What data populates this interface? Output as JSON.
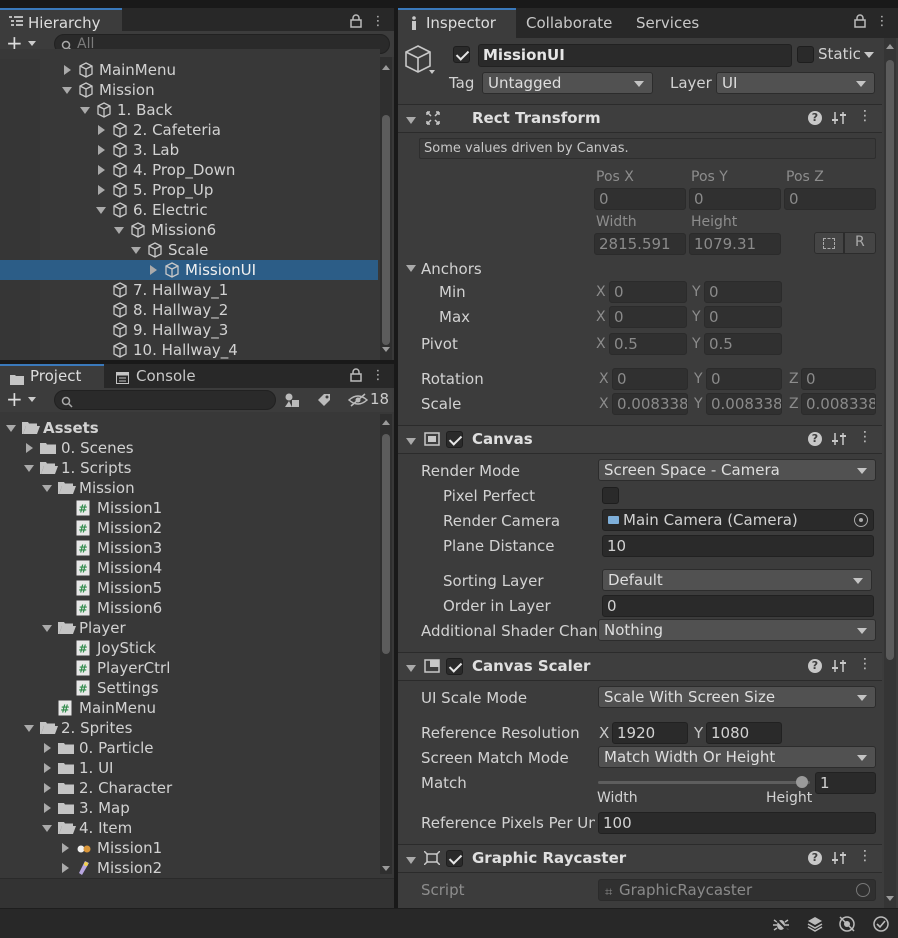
{
  "hierarchy": {
    "tab": "Hierarchy",
    "search_placeholder": "All",
    "rows": [
      {
        "label": "MainMenu"
      },
      {
        "label": "Mission"
      },
      {
        "label": "1. Back"
      },
      {
        "label": "2. Cafeteria"
      },
      {
        "label": "3. Lab"
      },
      {
        "label": "4. Prop_Down"
      },
      {
        "label": "5. Prop_Up"
      },
      {
        "label": "6. Electric"
      },
      {
        "label": "Mission6"
      },
      {
        "label": "Scale"
      },
      {
        "label": "MissionUI"
      },
      {
        "label": "7. Hallway_1"
      },
      {
        "label": "8. Hallway_2"
      },
      {
        "label": "9. Hallway_3"
      },
      {
        "label": "10. Hallway_4"
      }
    ]
  },
  "project": {
    "tabs": [
      "Project",
      "Console"
    ],
    "hidden_count": "18",
    "rows": [
      {
        "label": "Assets"
      },
      {
        "label": "0. Scenes"
      },
      {
        "label": "1. Scripts"
      },
      {
        "label": "Mission"
      },
      {
        "label": "Mission1"
      },
      {
        "label": "Mission2"
      },
      {
        "label": "Mission3"
      },
      {
        "label": "Mission4"
      },
      {
        "label": "Mission5"
      },
      {
        "label": "Mission6"
      },
      {
        "label": "Player"
      },
      {
        "label": "JoyStick"
      },
      {
        "label": "PlayerCtrl"
      },
      {
        "label": "Settings"
      },
      {
        "label": "MainMenu"
      },
      {
        "label": "2. Sprites"
      },
      {
        "label": "0. Particle"
      },
      {
        "label": "1. UI"
      },
      {
        "label": "2. Character"
      },
      {
        "label": "3. Map"
      },
      {
        "label": "4. Item"
      },
      {
        "label": "Mission1"
      },
      {
        "label": "Mission2"
      }
    ]
  },
  "inspector": {
    "tabs": [
      "Inspector",
      "Collaborate",
      "Services"
    ],
    "object_name": "MissionUI",
    "static_label": "Static",
    "tag_label": "Tag",
    "tag_value": "Untagged",
    "layer_label": "Layer",
    "layer_value": "UI",
    "rect_transform": {
      "title": "Rect Transform",
      "notice": "Some values driven by Canvas.",
      "pos_x_label": "Pos X",
      "pos_y_label": "Pos Y",
      "pos_z_label": "Pos Z",
      "pos_x": "0",
      "pos_y": "0",
      "pos_z": "0",
      "width_label": "Width",
      "height_label": "Height",
      "width": "2815.591",
      "height": "1079.31",
      "anchors_label": "Anchors",
      "min_label": "Min",
      "min_x": "0",
      "min_y": "0",
      "max_label": "Max",
      "max_x": "0",
      "max_y": "0",
      "pivot_label": "Pivot",
      "pivot_x": "0.5",
      "pivot_y": "0.5",
      "rotation_label": "Rotation",
      "rot_x": "0",
      "rot_y": "0",
      "rot_z": "0",
      "scale_label": "Scale",
      "scale_x": "0.008338",
      "scale_y": "0.008338",
      "scale_z": "0.008338",
      "r_button": "R"
    },
    "canvas": {
      "title": "Canvas",
      "render_mode_label": "Render Mode",
      "render_mode": "Screen Space - Camera",
      "pixel_perfect_label": "Pixel Perfect",
      "render_camera_label": "Render Camera",
      "render_camera": "Main Camera (Camera)",
      "plane_distance_label": "Plane Distance",
      "plane_distance": "10",
      "sorting_layer_label": "Sorting Layer",
      "sorting_layer": "Default",
      "order_label": "Order in Layer",
      "order": "0",
      "shader_label": "Additional Shader Chann",
      "shader": "Nothing"
    },
    "canvas_scaler": {
      "title": "Canvas Scaler",
      "scale_mode_label": "UI Scale Mode",
      "scale_mode": "Scale With Screen Size",
      "ref_res_label": "Reference Resolution",
      "ref_x": "1920",
      "ref_y": "1080",
      "match_mode_label": "Screen Match Mode",
      "match_mode": "Match Width Or Height",
      "match_label": "Match",
      "match_value": "1",
      "match_fraction": 1,
      "width_label": "Width",
      "height_label": "Height",
      "ref_ppu_label": "Reference Pixels Per Un",
      "ref_ppu": "100"
    },
    "raycaster": {
      "title": "Graphic Raycaster",
      "script_label": "Script",
      "script": "GraphicRaycaster"
    },
    "x": "X",
    "y": "Y",
    "z": "Z"
  },
  "colors": {
    "selection": "#2c5d87",
    "accent": "#3a79bb"
  }
}
